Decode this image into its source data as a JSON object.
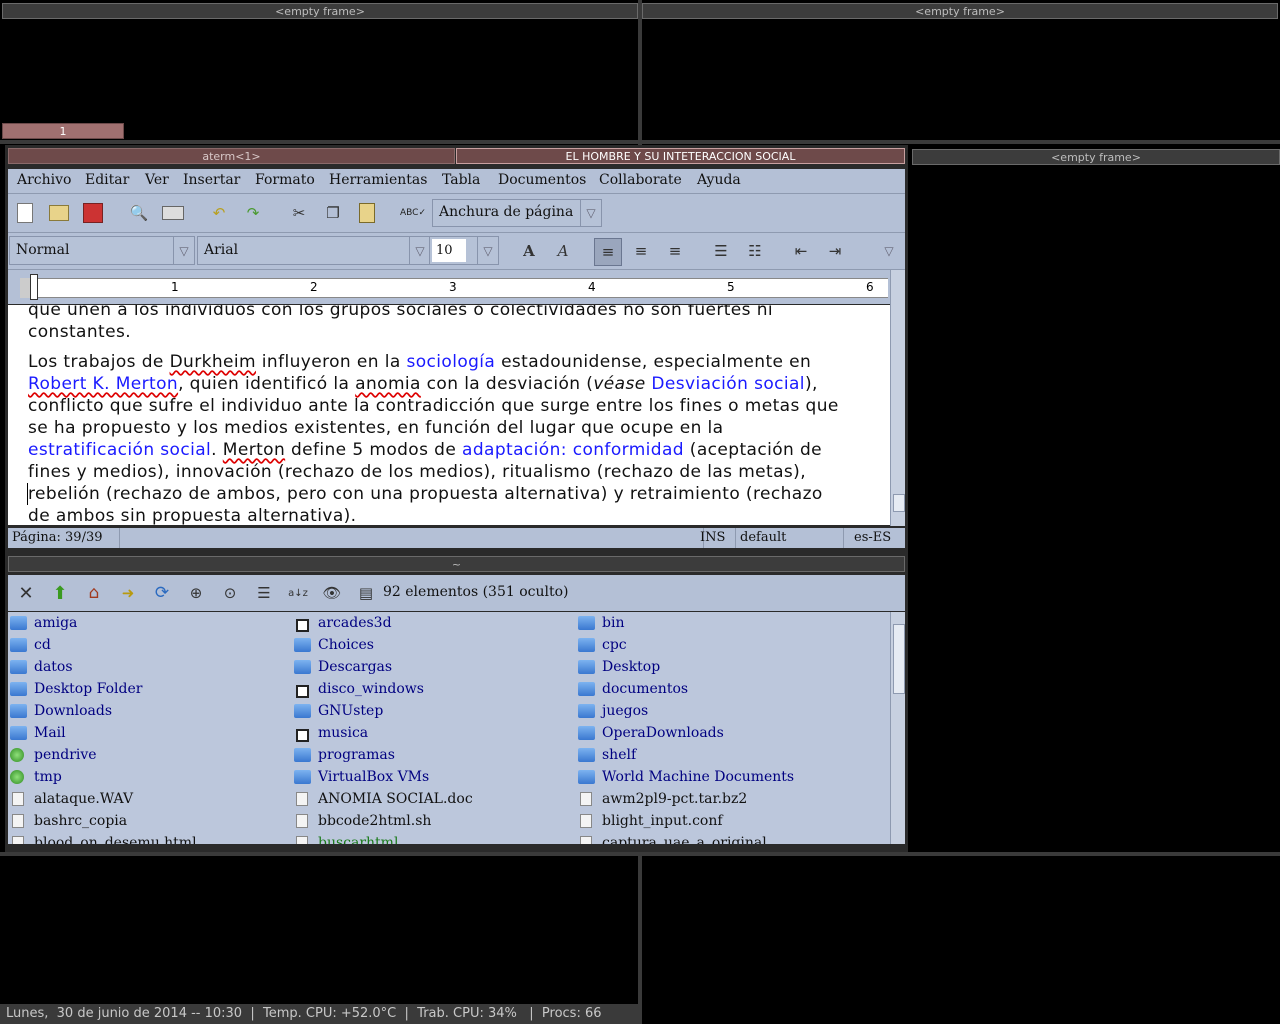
{
  "frames": {
    "empty_label": "<empty frame>",
    "workspace_tab": "1",
    "tab_aterm": "aterm<1>",
    "tab_abiword": "EL HOMBRE Y SU INTETERACCION SOCIAL",
    "fm_frame_title": "~"
  },
  "menu": {
    "items": [
      "Archivo",
      "Editar",
      "Ver",
      "Insertar",
      "Formato",
      "Herramientas",
      "Tabla",
      "Documentos",
      "Collaborate",
      "Ayuda"
    ]
  },
  "toolbar": {
    "zoom": "Anchura de página",
    "style": "Normal",
    "font": "Arial",
    "size": "10"
  },
  "ruler": {
    "marks": [
      "1",
      "2",
      "3",
      "4",
      "5",
      "6"
    ]
  },
  "document": {
    "line0a": "que unen a los individuos con los grupos sociales o colectividades no son fuertes ni",
    "line0b": "constantes.",
    "p1": {
      "t1": " Los trabajos de ",
      "durkheim": "Durkheim",
      "t2": " influyeron en la ",
      "sociologia": "sociología",
      "t3": " estadounidense, especialmente en",
      "merton_link": "Robert K. Merton",
      "t4": ", quien identificó la ",
      "anomia": "anomia",
      "t5": " con la desviación (",
      "vease": "véase",
      "t6": " ",
      "desviacion": "Desviación social",
      "t7": "),",
      "l3": "conflicto que sufre el individuo ante la contradicción que surge entre los fines o metas que",
      "l4": "se ha propuesto y los medios existentes, en función del lugar que ocupe en la",
      "estratificacion": "estratificación social",
      "t8": ". ",
      "merton2": "Merton",
      "t9": " define 5 modos de ",
      "adaptacion": "adaptación: conformidad",
      "t10": " (aceptación de",
      "l6": "fines y medios), innovación (rechazo de los medios), ritualismo (rechazo de las metas),",
      "l7": "rebelión (rechazo de ambos, pero con una propuesta alternativa) y retraimiento (rechazo",
      "l8": "de ambos sin propuesta alternativa)."
    }
  },
  "status": {
    "page": "Página: 39/39",
    "ins": "INS",
    "mode": "default",
    "lang": "es-ES"
  },
  "filemanager": {
    "count": "92 elementos (351 oculto)",
    "columns": [
      [
        {
          "name": "amiga",
          "icon": "folder"
        },
        {
          "name": "cd",
          "icon": "folder"
        },
        {
          "name": "datos",
          "icon": "folder"
        },
        {
          "name": "Desktop Folder",
          "icon": "folder"
        },
        {
          "name": "Downloads",
          "icon": "folder"
        },
        {
          "name": "Mail",
          "icon": "folder"
        },
        {
          "name": "pendrive",
          "icon": "drive-link"
        },
        {
          "name": "tmp",
          "icon": "drive-link"
        },
        {
          "name": "alataque.WAV",
          "icon": "audio"
        },
        {
          "name": "bashrc_copia",
          "icon": "file"
        },
        {
          "name": "blood_on_desemu.html",
          "icon": "html"
        }
      ],
      [
        {
          "name": "arcades3d",
          "icon": "link"
        },
        {
          "name": "Choices",
          "icon": "folder"
        },
        {
          "name": "Descargas",
          "icon": "folder"
        },
        {
          "name": "disco_windows",
          "icon": "link"
        },
        {
          "name": "GNUstep",
          "icon": "folder"
        },
        {
          "name": "musica",
          "icon": "link"
        },
        {
          "name": "programas",
          "icon": "folder"
        },
        {
          "name": "VirtualBox VMs",
          "icon": "folder"
        },
        {
          "name": "ANOMIA SOCIAL.doc",
          "icon": "doc"
        },
        {
          "name": "bbcode2html.sh",
          "icon": "script"
        },
        {
          "name": "buscarhtml",
          "icon": "exec"
        }
      ],
      [
        {
          "name": "bin",
          "icon": "folder"
        },
        {
          "name": "cpc",
          "icon": "folder"
        },
        {
          "name": "Desktop",
          "icon": "folder"
        },
        {
          "name": "documentos",
          "icon": "folder"
        },
        {
          "name": "juegos",
          "icon": "folder"
        },
        {
          "name": "OperaDownloads",
          "icon": "folder"
        },
        {
          "name": "shelf",
          "icon": "folder"
        },
        {
          "name": "World Machine Documents",
          "icon": "folder"
        },
        {
          "name": "awm2pl9-pct.tar.bz2",
          "icon": "archive"
        },
        {
          "name": "blight_input.conf",
          "icon": "file"
        },
        {
          "name": "captura_uae_a_original",
          "icon": "file"
        }
      ]
    ]
  },
  "statusline": "Lunes,  30 de junio de 2014 -- 10:30  |  Temp. CPU: +52.0°C  |  Trab. CPU: 34%   |  Procs: 66"
}
